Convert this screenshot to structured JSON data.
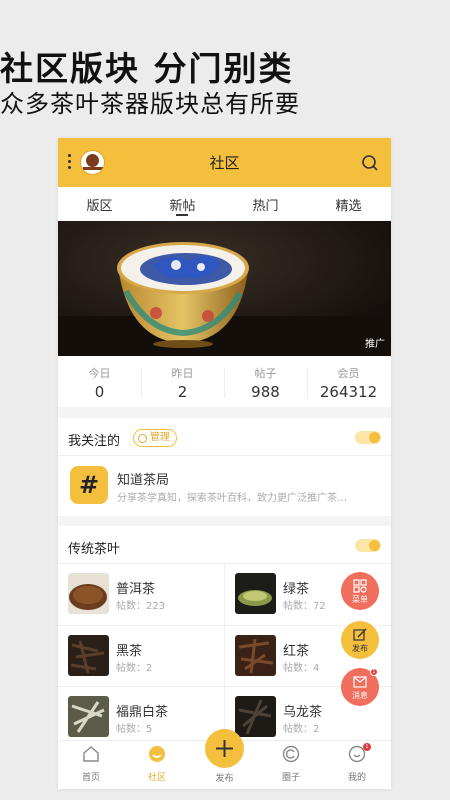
{
  "promo": {
    "title": "社区版块 分门别类",
    "subtitle": "众多茶叶茶器版块总有所要"
  },
  "header": {
    "title": "社区"
  },
  "tabs": [
    "版区",
    "新帖",
    "热门",
    "精选"
  ],
  "active_tab": "新帖",
  "banner": {
    "tag": "推广"
  },
  "stats": [
    {
      "label": "今日",
      "value": "0"
    },
    {
      "label": "昨日",
      "value": "2"
    },
    {
      "label": "帖子",
      "value": "988"
    },
    {
      "label": "会员",
      "value": "264312"
    }
  ],
  "followed": {
    "title": "我关注的",
    "manage_label": "管理",
    "board": {
      "icon_glyph": "#",
      "title": "知道茶局",
      "desc": "分享茶学真知，探索茶叶百科，致力更广泛推广茶…"
    }
  },
  "traditional": {
    "title": "传统茶叶",
    "items": [
      {
        "name": "普洱茶",
        "count": "帖数：223"
      },
      {
        "name": "绿茶",
        "count": "帖数：72"
      },
      {
        "name": "黑茶",
        "count": "帖数：2"
      },
      {
        "name": "红茶",
        "count": "帖数：4"
      },
      {
        "name": "福鼎白茶",
        "count": "帖数：5"
      },
      {
        "name": "乌龙茶",
        "count": "帖数：2"
      }
    ]
  },
  "fabs": [
    {
      "label": "菜单",
      "color": "#ef6e5c"
    },
    {
      "label": "发布",
      "color": "#f5bf3e"
    },
    {
      "label": "消息",
      "color": "#ef6e5c",
      "badge": "1"
    }
  ],
  "tabbar": {
    "items": [
      "首页",
      "社区",
      "发布",
      "圈子",
      "我的"
    ],
    "badge": "1"
  },
  "colors": {
    "accent": "#f5bf3e",
    "fab_red": "#ef6e5c"
  }
}
